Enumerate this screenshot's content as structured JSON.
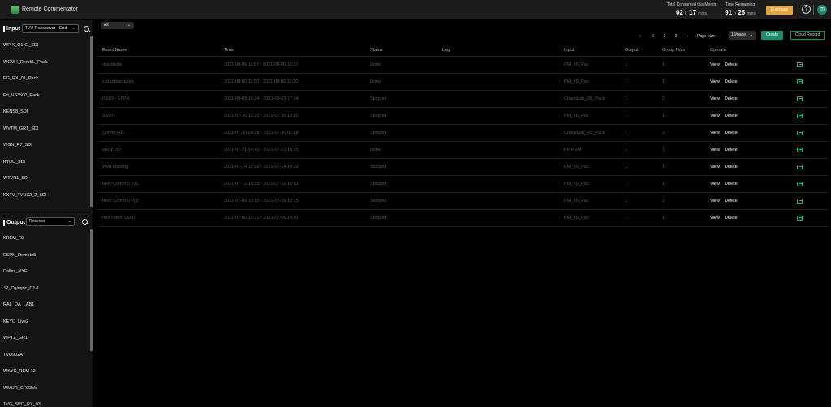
{
  "app": {
    "title": "Remote Commentator"
  },
  "stats": {
    "consumed_label": "Total Consumed this Month",
    "consumed_h": "02",
    "consumed_m": "17",
    "remaining_label": "Time Remaining",
    "remaining_h": "91",
    "remaining_m": "25",
    "h_unit": "h",
    "m_unit": "mins"
  },
  "header": {
    "purchase_label": "Purchase",
    "help_glyph": "?",
    "avatar_initial": "m"
  },
  "input_section": {
    "title": "Input",
    "selected_type": "TVU Transceiver - Grid",
    "items": [
      "WPIX_Q1X2_SDI",
      "WCMH_RemSL_Pack",
      "EG_RX_01_Pack",
      "Ed_VS3500_Pack",
      "KENS8_SDI",
      "WVTM_GR1_SDI",
      "WGN_R7_SDI",
      "KTUU_SDI",
      "WTVR1_SDI",
      "KXTV_TVUX2_2_SDI"
    ]
  },
  "output_section": {
    "title": "Output",
    "selected_type": "Receiver",
    "items": [
      "KREM_R3",
      "ESPN_Remote5",
      "Dallas_NYE",
      "JP_Olympic_D1-1",
      "RAL_QA_LAB1",
      "KEYC_Live2",
      "WPTZ_GR1",
      "TVU902A",
      "WKYC_REM-12",
      "WMUR_GR33old",
      "TVG_SPO_RX_03"
    ]
  },
  "toolbar": {
    "filter_value": "All",
    "pages": [
      "1",
      "2",
      "3"
    ],
    "current_page": "1",
    "prev_glyph": "‹",
    "next_glyph": "›",
    "page_size_label": "Page size:",
    "page_size_value": "10/page",
    "create_label": "Create",
    "cloud_record_label": "Cloud Record"
  },
  "table": {
    "columns": [
      "Event Name",
      "Time",
      "Status",
      "Log",
      "Input",
      "Output",
      "Group Num",
      "Operate"
    ],
    "view_label": "View",
    "delete_label": "Delete",
    "rows": [
      {
        "name": "dasdsada",
        "time": "2021-08-06 11:57 - 2021-08-06 12:27",
        "status": "Done",
        "log": "",
        "input": "PM_X6_Pac",
        "output": "1",
        "group": "1"
      },
      {
        "name": "sdsaddasdadsa",
        "time": "2021-08-06 11:50 - 2021-08-06 12:20",
        "status": "Done",
        "log": "",
        "input": "PM_X6_Pac",
        "output": "1",
        "group": "1"
      },
      {
        "name": "08/03 - ESPN",
        "time": "2021-08-03 15:34 - 2021-08-03 17:34",
        "status": "Stopped",
        "log": "",
        "input": "ChaosLab_R5_Pack",
        "output": "1",
        "group": "2"
      },
      {
        "name": "30/07",
        "time": "2021-07-30 12:20 - 2021-07-30 13:20",
        "status": "Stopped",
        "log": "",
        "input": "PM_X6_Pac",
        "output": "1",
        "group": "1"
      },
      {
        "name": "Comm Aus",
        "time": "2021-07-30 00:28 - 2021-07-30 02:28",
        "status": "Stopped",
        "log": "",
        "input": "ChaosLab_R5_Pack",
        "output": "1",
        "group": "3"
      },
      {
        "name": "wed21/07",
        "time": "2021-07-21 14:40 - 2021-07-21 15:25",
        "status": "Done",
        "log": "",
        "input": "PP PGM",
        "output": "1",
        "group": "1"
      },
      {
        "name": "Wed Meeting",
        "time": "2021-07-14 12:59 - 2021-07-14 14:29",
        "status": "Stopped",
        "log": "",
        "input": "PM_X6_Pac",
        "output": "1",
        "group": "1"
      },
      {
        "name": "Rem Comm 07/12",
        "time": "2021-07-12 15:33 - 2021-07-12 16:03",
        "status": "Stopped",
        "log": "",
        "input": "PM_X6_Pac",
        "output": "1",
        "group": "1"
      },
      {
        "name": "Rem Comm 07/09",
        "time": "2021-07-09 13:15 - 2021-07-09 15:15",
        "status": "Stopped",
        "log": "",
        "input": "PM_X6_Pac",
        "output": "1",
        "group": "2"
      },
      {
        "name": "rem comm 06/07",
        "time": "2021-07-06 12:21 - 2021-07-06 14:01",
        "status": "Stopped",
        "log": "",
        "input": "PM_X6_Pac",
        "output": "1",
        "group": "1"
      }
    ]
  },
  "colors": {
    "accent": "#1d8a6e",
    "purchase": "#e8a33a",
    "active_page": "#e8a33a"
  }
}
